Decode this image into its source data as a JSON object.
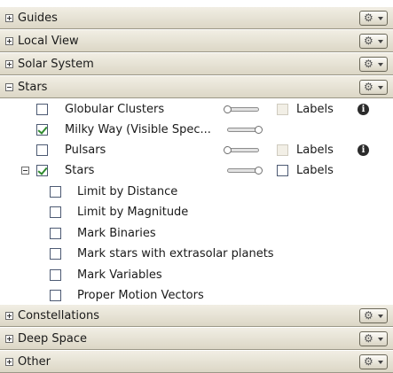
{
  "sections": [
    {
      "title": "Guides",
      "icon": "plus-box-icon"
    },
    {
      "title": "Local View",
      "icon": "plus-box-icon"
    },
    {
      "title": "Solar System",
      "icon": "plus-box-icon"
    },
    {
      "title": "Stars",
      "icon": "minus-box-icon"
    },
    {
      "title": "Constellations",
      "icon": "plus-box-icon"
    },
    {
      "title": "Deep Space",
      "icon": "plus-box-icon"
    },
    {
      "title": "Other",
      "icon": "plus-box-icon"
    }
  ],
  "stars_items": [
    {
      "label": "Globular Clusters",
      "checked": false,
      "slider_level": 0.0,
      "labels_text": "Labels",
      "labels_checked": false,
      "labels_enabled": false,
      "has_info": true
    },
    {
      "label": "Milky Way (Visible Spec...",
      "checked": true,
      "slider_level": 1.0,
      "has_info": false
    },
    {
      "label": "Pulsars",
      "checked": false,
      "slider_level": 0.0,
      "labels_text": "Labels",
      "labels_checked": false,
      "labels_enabled": false,
      "has_info": true
    },
    {
      "label": "Stars",
      "checked": true,
      "slider_level": 1.0,
      "labels_text": "Labels",
      "labels_checked": false,
      "labels_enabled": true,
      "has_info": false,
      "expanded": true
    }
  ],
  "stars_subitems": [
    {
      "label": "Limit by Distance",
      "checked": false
    },
    {
      "label": "Limit by Magnitude",
      "checked": false
    },
    {
      "label": "Mark Binaries",
      "checked": false
    },
    {
      "label": "Mark stars with extrasolar planets",
      "checked": false
    },
    {
      "label": "Mark Variables",
      "checked": false
    },
    {
      "label": "Proper Motion Vectors",
      "checked": false
    }
  ],
  "icons": {
    "gear": "gear-icon",
    "info": "info-icon",
    "dropdown": "chevron-down-icon"
  },
  "colors": {
    "header_top": "#f1eee4",
    "header_bottom": "#dcd7c6",
    "check": "#2e8a2e",
    "checkbox_border": "#4d5a73"
  }
}
